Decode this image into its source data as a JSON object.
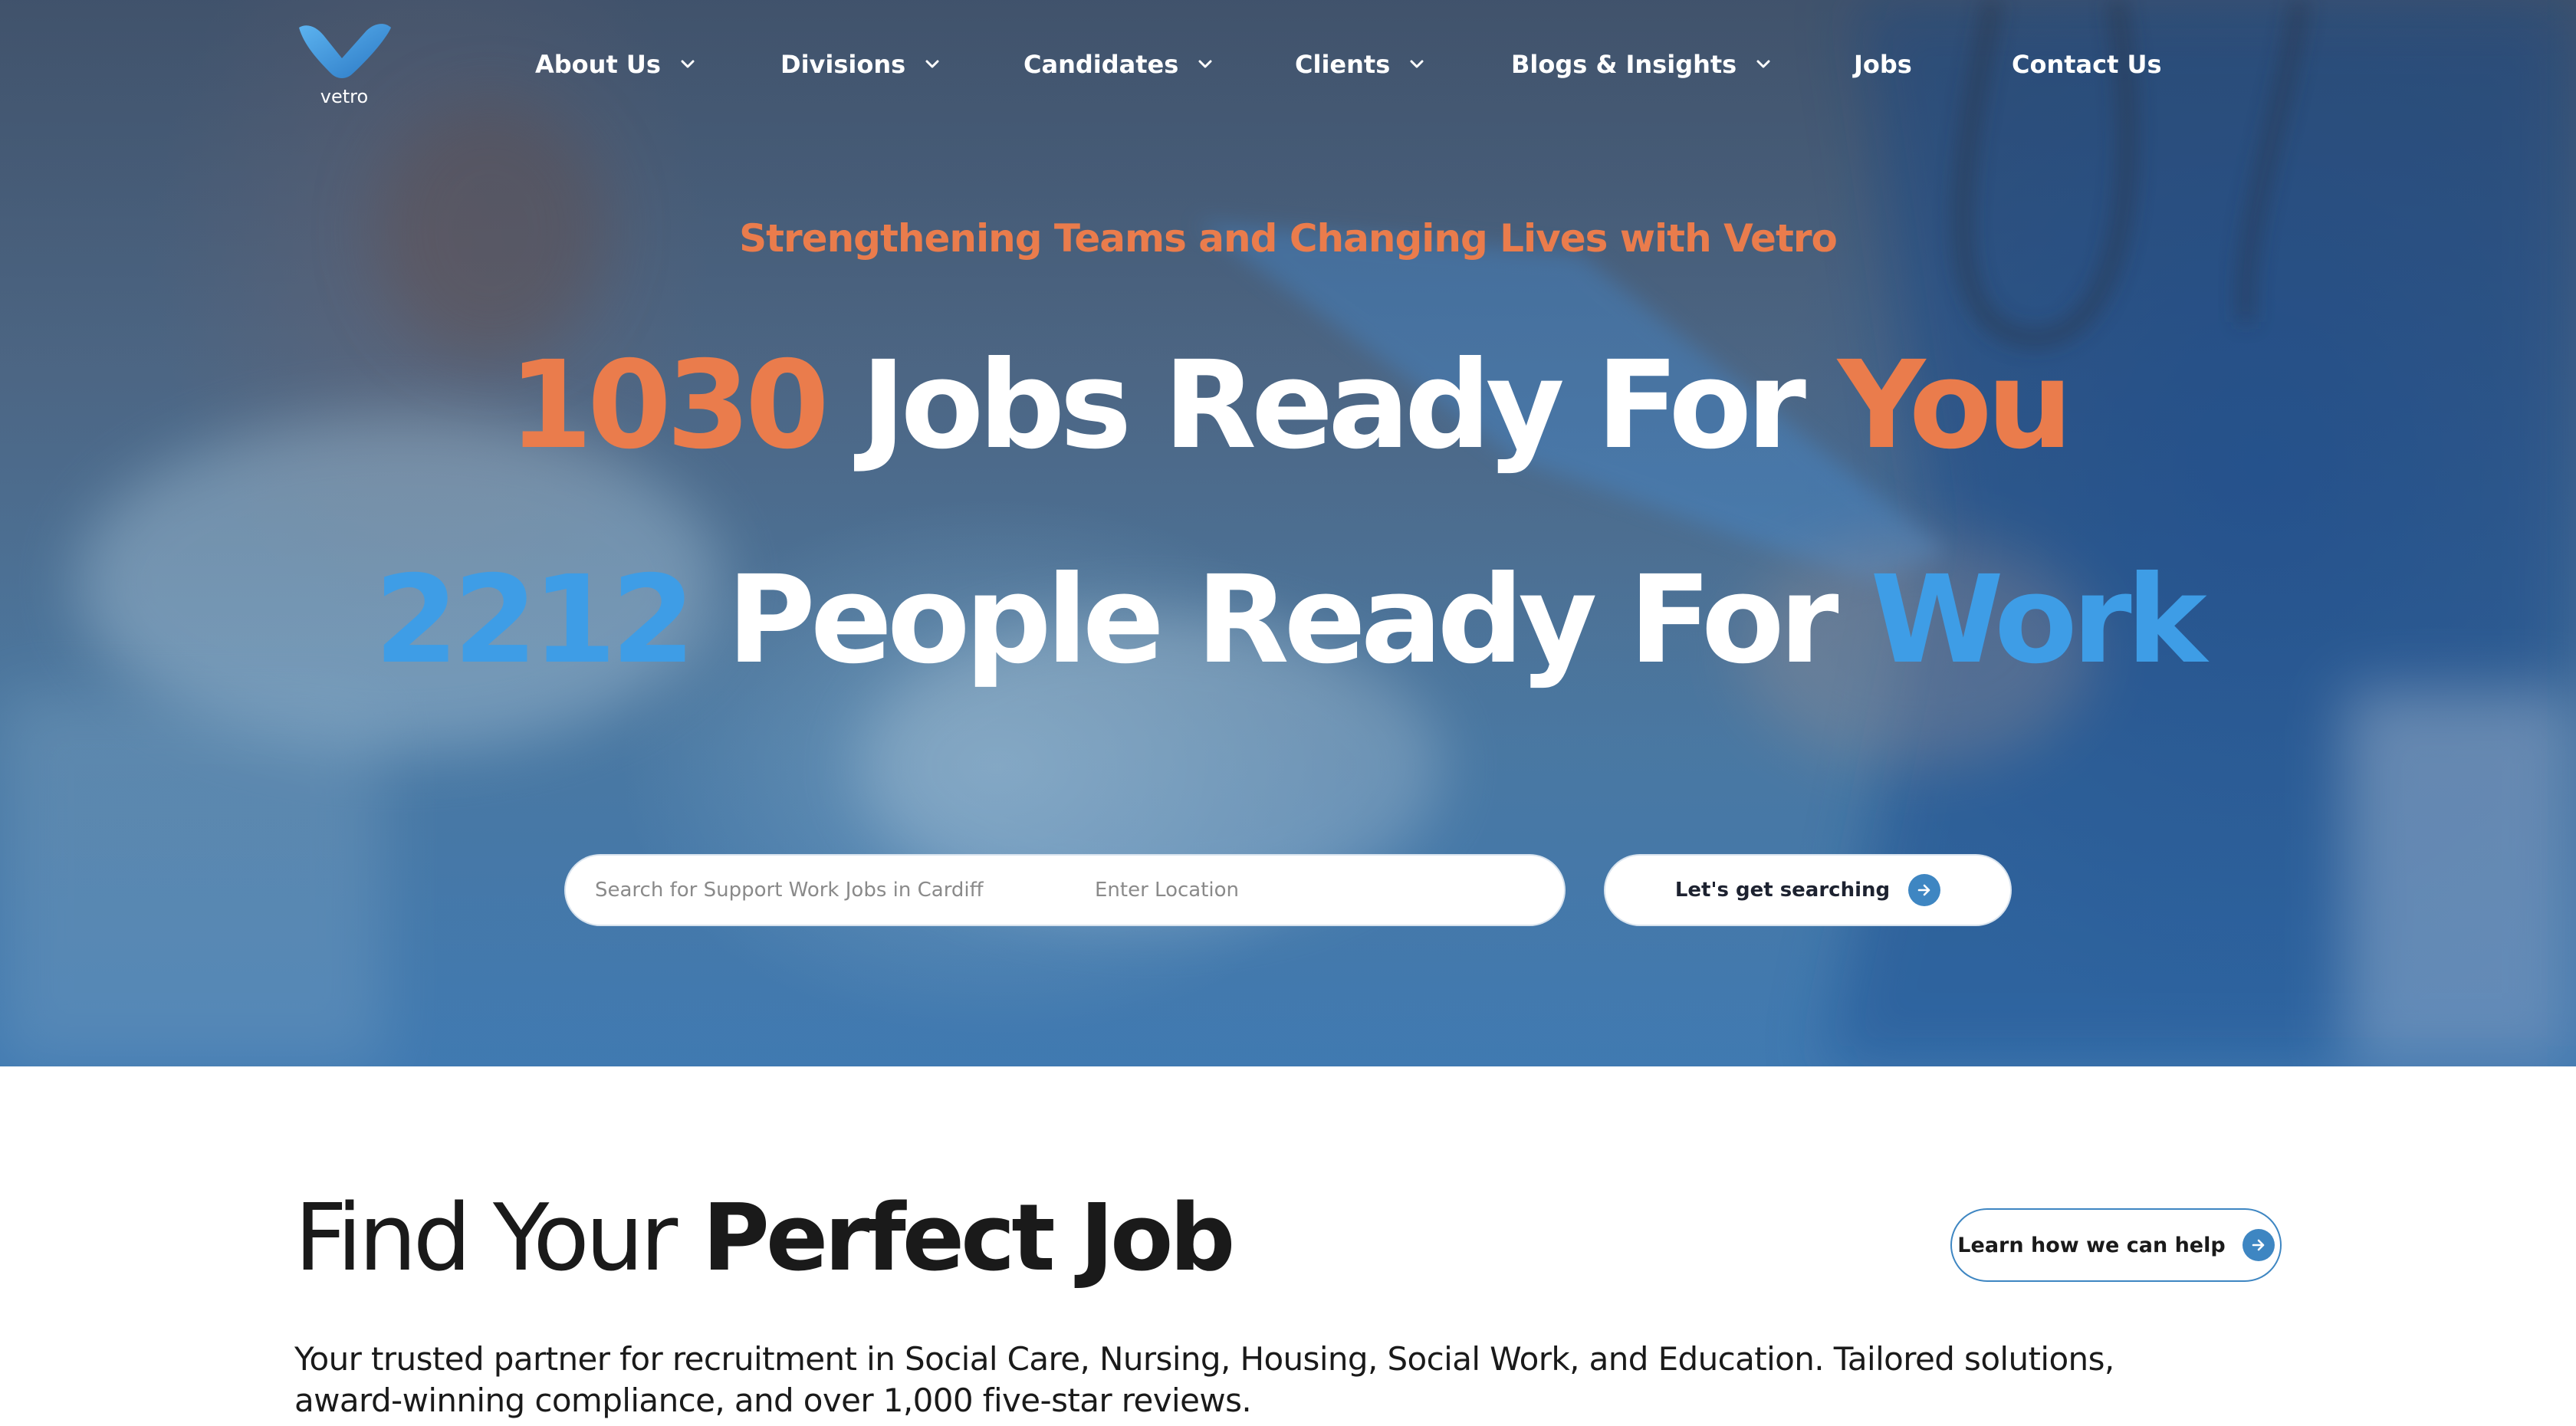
{
  "brand": {
    "name": "vetro"
  },
  "nav": {
    "items": [
      {
        "label": "About Us",
        "has_dropdown": true
      },
      {
        "label": "Divisions",
        "has_dropdown": true
      },
      {
        "label": "Candidates",
        "has_dropdown": true
      },
      {
        "label": "Clients",
        "has_dropdown": true
      },
      {
        "label": "Blogs & Insights",
        "has_dropdown": true
      },
      {
        "label": "Jobs",
        "has_dropdown": false
      },
      {
        "label": "Contact Us",
        "has_dropdown": false
      }
    ]
  },
  "hero": {
    "tagline": "Strengthening Teams and Changing Lives with Vetro",
    "line1": {
      "count": "1030",
      "text": "Jobs Ready For",
      "accent": "You"
    },
    "line2": {
      "count": "2212",
      "text": "People Ready For",
      "accent": "Work"
    },
    "search": {
      "keyword_placeholder": "Search for Support Work Jobs in Cardiff",
      "location_placeholder": "Enter Location",
      "button_label": "Let's get searching"
    }
  },
  "section": {
    "title_light": "Find Your",
    "title_bold": "Perfect Job",
    "cta_label": "Learn how we can help",
    "description": "Your trusted partner for recruitment in Social Care, Nursing, Housing, Social Work, and Education. Tailored solutions, award-winning compliance, and over 1,000 five-star reviews."
  },
  "colors": {
    "accent_orange": "#ea7c4c",
    "accent_blue": "#3e9de6",
    "button_blue": "#3e86c2"
  },
  "icons": [
    "vetro-logo-icon",
    "chevron-down-icon",
    "arrow-right-icon"
  ]
}
